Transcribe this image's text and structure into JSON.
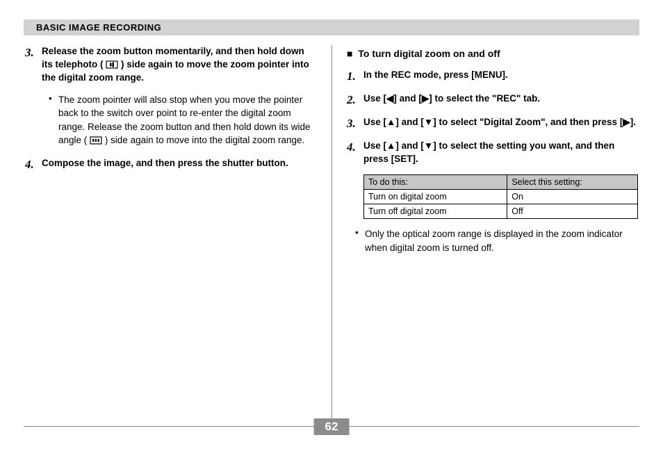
{
  "header": "BASIC IMAGE RECORDING",
  "page_number": "62",
  "left": {
    "step3": {
      "num": "3.",
      "pre": "Release the zoom button momentarily, and then hold down its telephoto (",
      "post": ") side again to move the zoom pointer into the digital zoom range."
    },
    "bullet1": {
      "pre": "The zoom pointer will also stop when you move the pointer back to the switch over point to re-enter the digital zoom range. Release the zoom button and then hold down its wide angle (",
      "post": ") side again to move into the digital zoom range."
    },
    "step4": {
      "num": "4.",
      "text": "Compose the image, and then press the shutter button."
    }
  },
  "right": {
    "subhead": "To turn digital zoom on and off",
    "step1": {
      "num": "1.",
      "text": "In the REC mode, press [MENU]."
    },
    "step2": {
      "num": "2.",
      "text": "Use [◀] and [▶] to select the \"REC\" tab."
    },
    "step3": {
      "num": "3.",
      "text": "Use [▲] and [▼] to select \"Digital Zoom\", and then press [▶]."
    },
    "step4": {
      "num": "4.",
      "text": "Use [▲] and [▼] to select the setting you want, and then press [SET]."
    },
    "table": {
      "head": [
        "To do this:",
        "Select this setting:"
      ],
      "rows": [
        [
          "Turn on digital zoom",
          "On"
        ],
        [
          "Turn off digital zoom",
          "Off"
        ]
      ]
    },
    "bullet": "Only the optical zoom range is displayed in the zoom indicator when digital zoom is turned off."
  }
}
